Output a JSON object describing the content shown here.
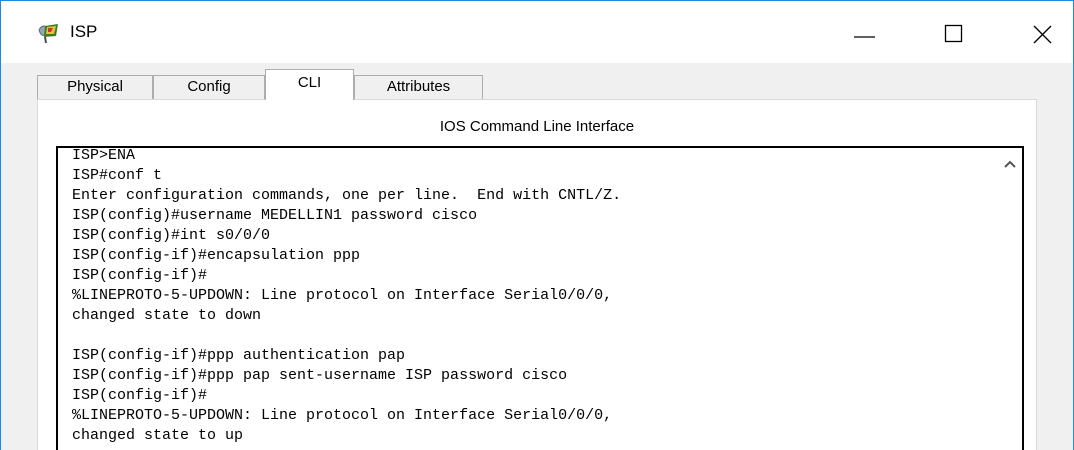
{
  "window": {
    "title": "ISP",
    "icon": "router-device-icon",
    "controls": {
      "minimize": "minimize-icon",
      "maximize": "maximize-icon",
      "close": "close-icon"
    }
  },
  "tabs": [
    {
      "label": "Physical"
    },
    {
      "label": "Config"
    },
    {
      "label": "CLI",
      "active": true
    },
    {
      "label": "Attributes"
    }
  ],
  "cli": {
    "heading": "IOS Command Line Interface",
    "output": "ISP>ENA\nISP#conf t\nEnter configuration commands, one per line.  End with CNTL/Z.\nISP(config)#username MEDELLIN1 password cisco\nISP(config)#int s0/0/0\nISP(config-if)#encapsulation ppp\nISP(config-if)#\n%LINEPROTO-5-UPDOWN: Line protocol on Interface Serial0/0/0,\nchanged state to down\n\nISP(config-if)#ppp authentication pap\nISP(config-if)#ppp pap sent-username ISP password cisco\nISP(config-if)#\n%LINEPROTO-5-UPDOWN: Line protocol on Interface Serial0/0/0,\nchanged state to up"
  },
  "colors": {
    "window_border": "#1e88e5",
    "body_background": "#f0f0f0",
    "terminal_border": "#000000"
  }
}
